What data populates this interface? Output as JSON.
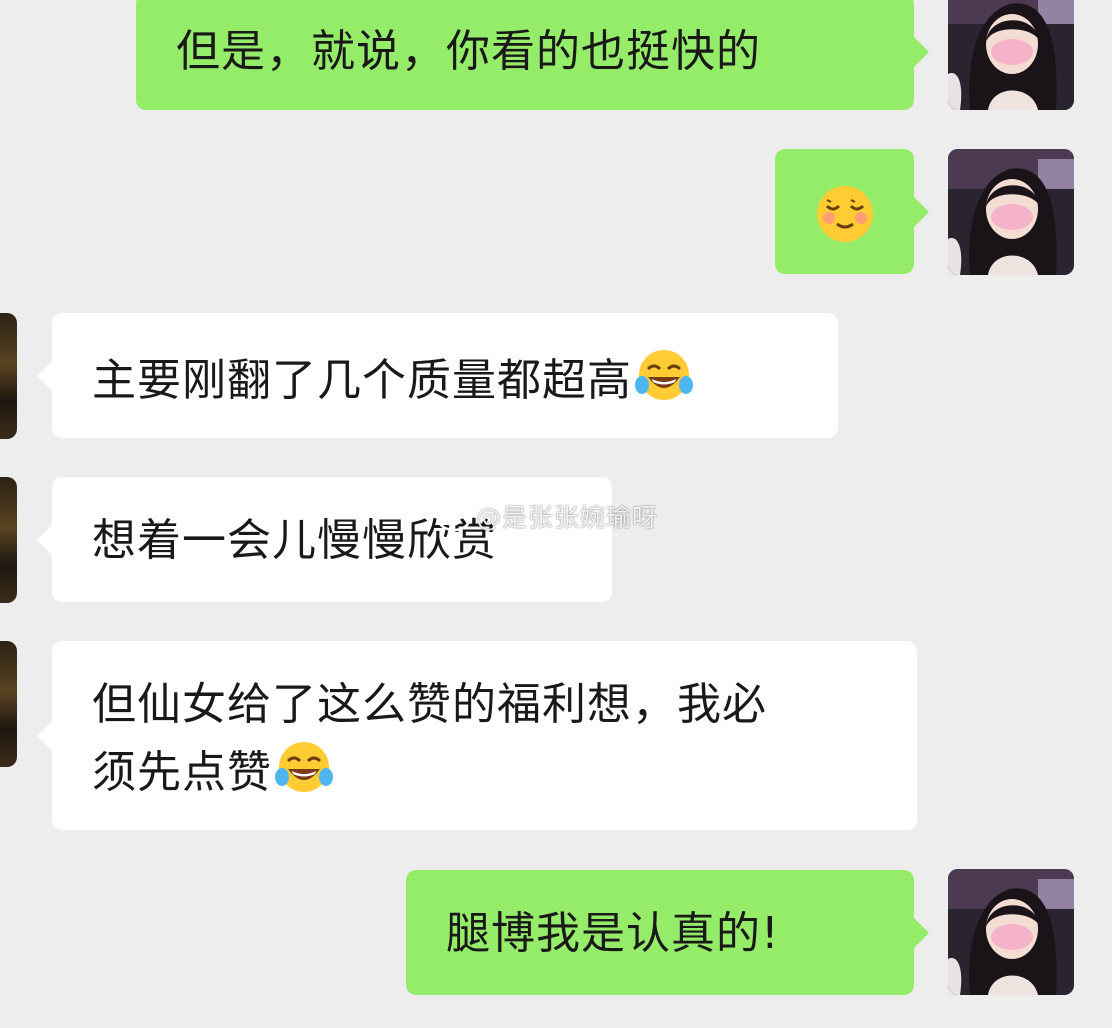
{
  "messages": [
    {
      "side": "right",
      "text": "但是，就说，你看的也挺快的"
    },
    {
      "side": "right",
      "emoji": "relieved-face"
    },
    {
      "side": "left",
      "text": "主要刚翻了几个质量都超高",
      "emoji": "face-with-tears-of-joy"
    },
    {
      "side": "left",
      "text": "想着一会儿慢慢欣赏"
    },
    {
      "side": "left",
      "line1": "但仙女给了这么赞的福利想，我必",
      "line2": "须先点赞",
      "emoji": "face-with-tears-of-joy"
    },
    {
      "side": "right",
      "text": "腿博我是认真的!"
    }
  ],
  "watermark": {
    "text": "@是张张婉瑜呀",
    "icon": "weibo-logo"
  },
  "colors": {
    "background": "#ededed",
    "sent_bubble": "#95ec69",
    "received_bubble": "#ffffff"
  }
}
